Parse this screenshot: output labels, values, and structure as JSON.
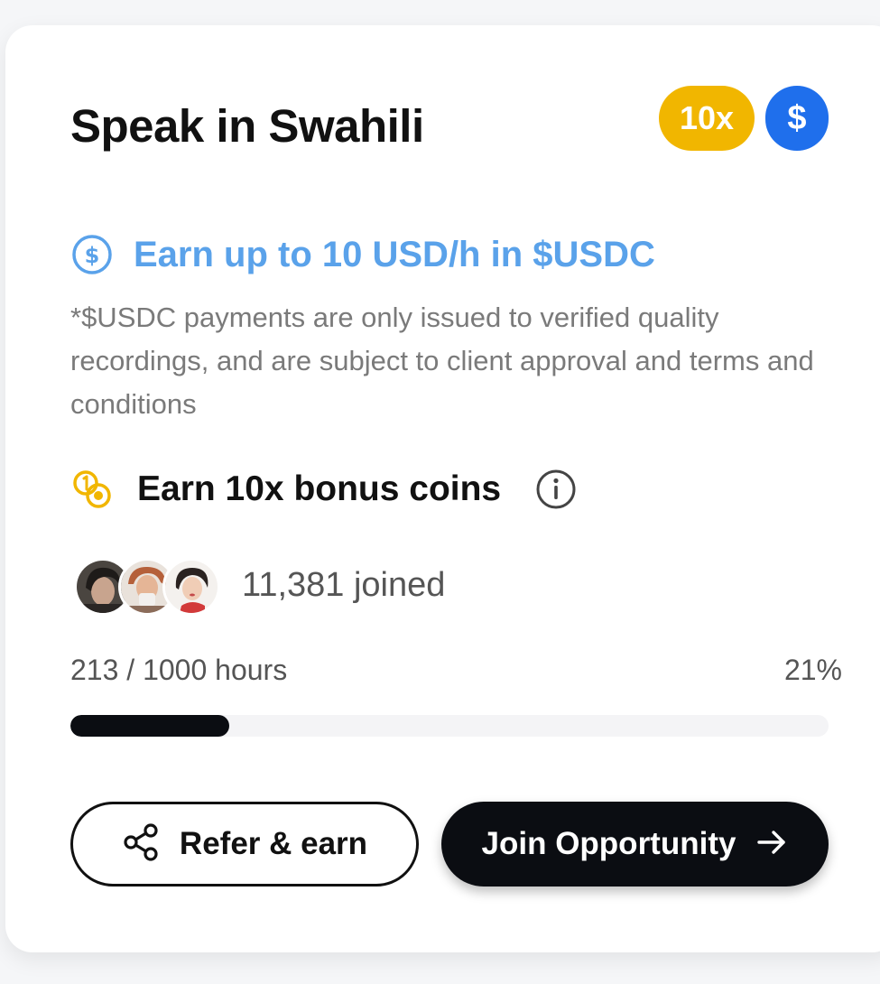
{
  "card": {
    "title": "Speak in Swahili",
    "badges": {
      "multiplier": "10x",
      "currency": "$",
      "multiplier_color": "#f1b600",
      "currency_color": "#1f6fec"
    },
    "earn": {
      "icon": "dollar-circle-icon",
      "text": "Earn up to 10 USD/h in $USDC",
      "color": "#5aa2ea"
    },
    "disclaimer": "*$USDC payments are only issued to verified quality recordings, and are subject to client approval and terms and conditions",
    "bonus": {
      "icon": "coins-icon",
      "text": "Earn 10x bonus coins",
      "info_icon": "info-icon",
      "icon_color": "#f1b600"
    },
    "participants": {
      "avatars": [
        "avatar-1",
        "avatar-2",
        "avatar-3"
      ],
      "joined_text": "11,381 joined"
    },
    "progress": {
      "label": "213 / 1000 hours",
      "percent_label": "21%",
      "fraction": 0.21
    },
    "actions": {
      "refer_label": "Refer & earn",
      "refer_icon": "share-icon",
      "join_label": "Join Opportunity",
      "join_icon": "arrow-right-icon"
    }
  }
}
